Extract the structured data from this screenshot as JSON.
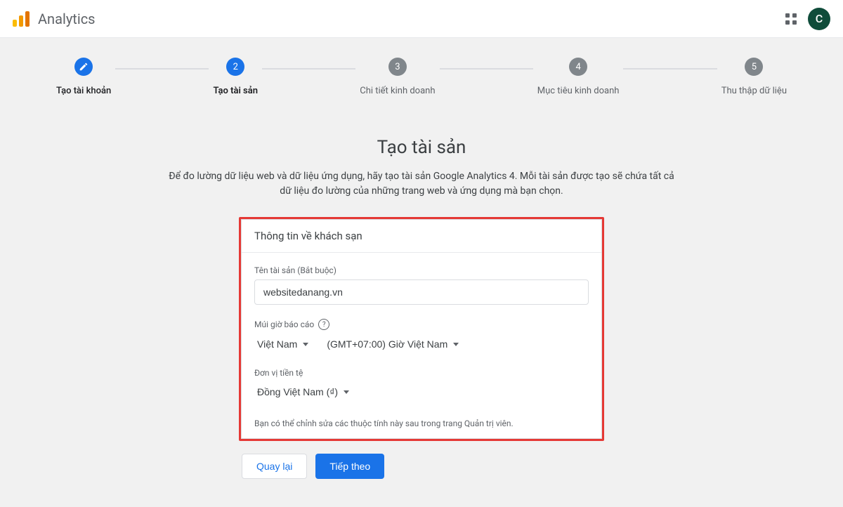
{
  "header": {
    "title": "Analytics",
    "avatar_letter": "C"
  },
  "stepper": {
    "steps": [
      {
        "label": "Tạo tài khoản",
        "state": "done"
      },
      {
        "label": "Tạo tài sản",
        "state": "active",
        "num": "2"
      },
      {
        "label": "Chi tiết kinh doanh",
        "state": "pending",
        "num": "3"
      },
      {
        "label": "Mục tiêu kinh doanh",
        "state": "pending",
        "num": "4"
      },
      {
        "label": "Thu thập dữ liệu",
        "state": "pending",
        "num": "5"
      }
    ]
  },
  "page": {
    "title": "Tạo tài sản",
    "description": "Để đo lường dữ liệu web và dữ liệu ứng dụng, hãy tạo tài sản Google Analytics 4. Mỗi tài sản được tạo sẽ chứa tất cả dữ liệu đo lường của những trang web và ứng dụng mà bạn chọn."
  },
  "card": {
    "header": "Thông tin về khách sạn",
    "property_name_label": "Tên tài sản (Bắt buộc)",
    "property_name_value": "websitedanang.vn",
    "timezone_label": "Múi giờ báo cáo",
    "timezone_country": "Việt Nam",
    "timezone_value": "(GMT+07:00) Giờ Việt Nam",
    "currency_label": "Đơn vị tiền tệ",
    "currency_value": "Đồng Việt Nam (₫)",
    "note": "Bạn có thể chỉnh sửa các thuộc tính này sau trong trang Quản trị viên."
  },
  "buttons": {
    "back": "Quay lại",
    "next": "Tiếp theo"
  }
}
